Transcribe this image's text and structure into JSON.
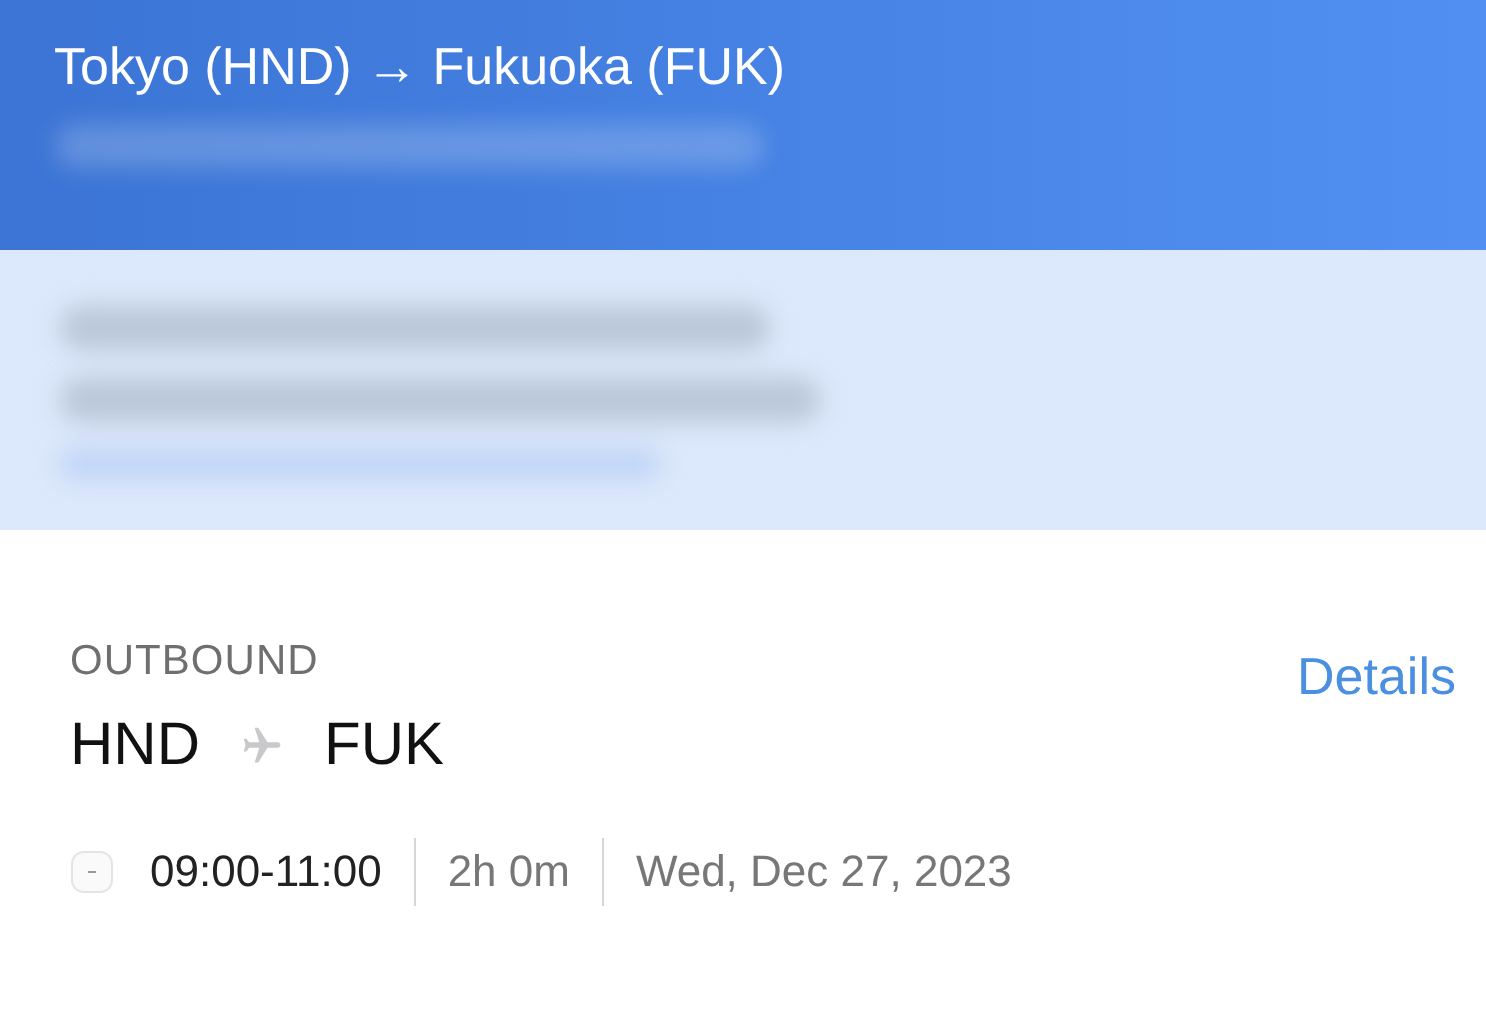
{
  "header": {
    "title": "Tokyo (HND) → Fukuoka (FUK)"
  },
  "outbound": {
    "label": "OUTBOUND",
    "details_link": "Details",
    "origin": "HND",
    "destination": "FUK",
    "times": "09:00-11:00",
    "duration": "2h 0m",
    "date": "Wed, Dec 27, 2023"
  }
}
